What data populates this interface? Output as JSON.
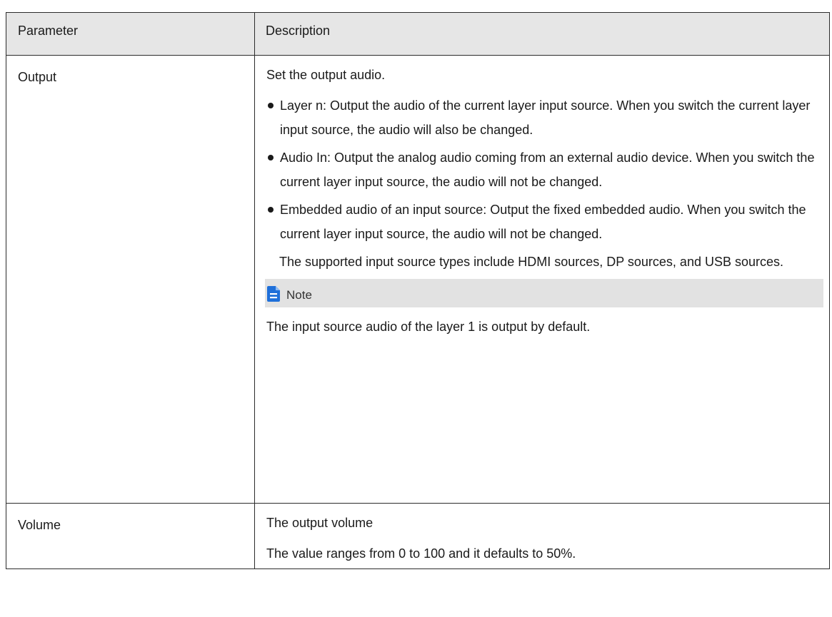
{
  "table": {
    "headers": [
      "Parameter",
      "Description"
    ],
    "rows": [
      {
        "parameter": "Output",
        "intro": "Set the output audio.",
        "bullets": [
          "Layer n: Output the audio of the current layer input source. When you switch the current layer input source, the audio will also be changed.",
          "Audio In: Output the analog audio coming from an external audio device. When you switch the current layer input source, the audio will not be changed.",
          "Embedded audio of an input source: Output the fixed embedded audio. When you switch the current layer input source, the audio will not be changed."
        ],
        "bullet_extra": "The supported input source types include HDMI sources, DP sources, and USB sources.",
        "note_label": "Note",
        "note_text": "The input source audio of the layer 1 is output by default."
      },
      {
        "parameter": "Volume",
        "lines": [
          "The output volume",
          "The value ranges from 0 to 100 and it defaults to 50%."
        ]
      }
    ]
  },
  "colors": {
    "header_bg": "#e6e6e6",
    "note_bg": "#e2e2e2",
    "note_icon": "#1e6fd9",
    "border": "#2b2b2b"
  },
  "icons": {
    "note": "note-document-icon"
  }
}
